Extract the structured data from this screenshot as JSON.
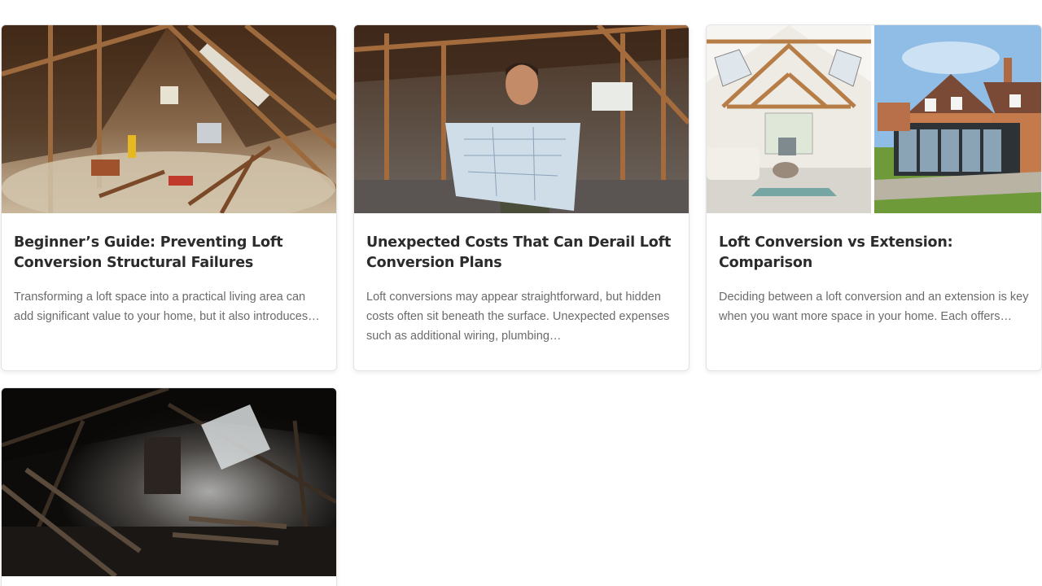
{
  "posts": [
    {
      "title": "Beginner’s Guide: Preventing Loft Conversion Structural Failures",
      "excerpt": "Transforming a loft space into a practical living area can add significant value to your home, but it also introduces…",
      "image_alt": "Messy unfinished loft with timber beams and debris"
    },
    {
      "title": "Unexpected Costs That Can Derail Loft Conversion Plans",
      "excerpt": "Loft conversions may appear straightforward, but hidden costs often sit beneath the surface. Unexpected expenses such as additional wiring, plumbing…",
      "image_alt": "Man reading building plans in an unfinished loft"
    },
    {
      "title": "Loft Conversion vs Extension: Comparison",
      "excerpt": "Deciding between a loft conversion and an extension is key when you want more space in your home. Each offers…",
      "image_alt": "Converted loft living room beside a brick house with glass extension"
    },
    {
      "title": "",
      "excerpt": "",
      "image_alt": "Dark loft space lit by a roof window"
    }
  ]
}
